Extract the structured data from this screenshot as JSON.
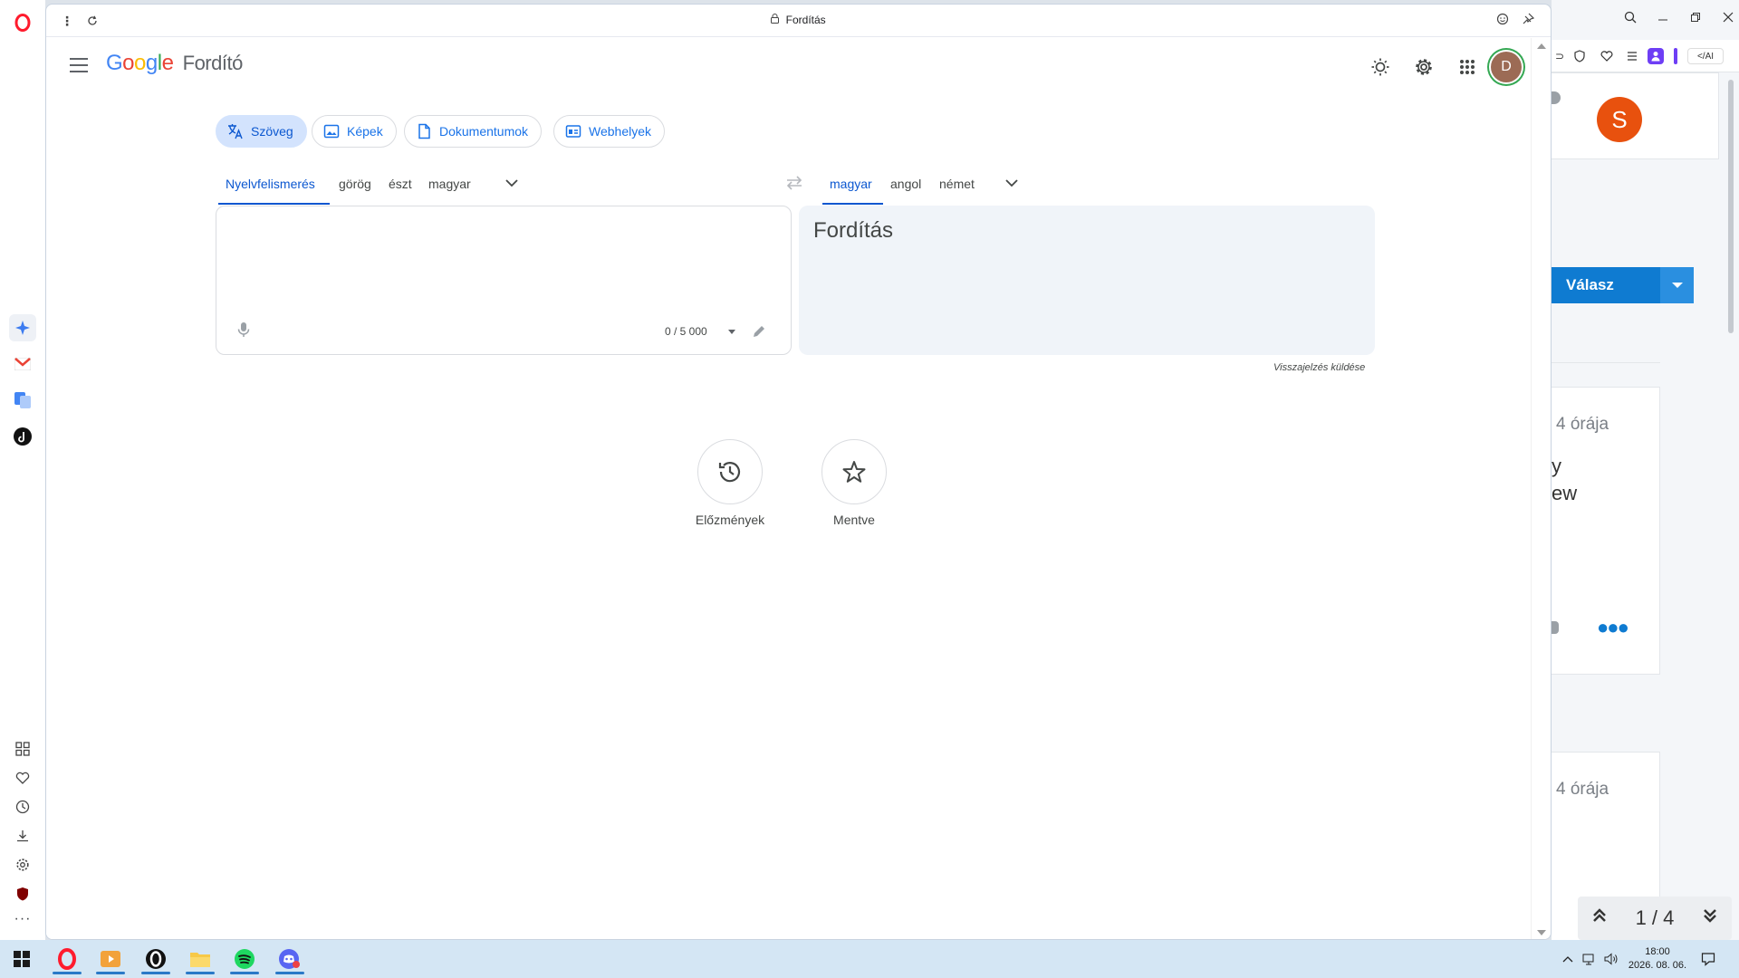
{
  "window": {
    "tab_title": "Fordítás"
  },
  "header": {
    "logo_google": [
      "G",
      "o",
      "o",
      "g",
      "l",
      "e"
    ],
    "product_name": "Fordító",
    "avatar_letter": "D"
  },
  "modes": [
    {
      "label": "Szöveg",
      "icon": "translate-icon",
      "active": true
    },
    {
      "label": "Képek",
      "icon": "image-icon",
      "active": false
    },
    {
      "label": "Dokumentumok",
      "icon": "document-icon",
      "active": false
    },
    {
      "label": "Webhelyek",
      "icon": "website-icon",
      "active": false
    }
  ],
  "source_languages": [
    "Nyelvfelismerés",
    "görög",
    "észt",
    "magyar"
  ],
  "target_languages": [
    "magyar",
    "angol",
    "német"
  ],
  "source": {
    "char_count": "0 / 5 000"
  },
  "target": {
    "placeholder": "Fordítás"
  },
  "feedback_link": "Visszajelzés küldése",
  "shortcuts": {
    "history": "Előzmények",
    "saved": "Mentve"
  },
  "right_panel": {
    "avatar_letter": "S",
    "reply_label": "Válasz",
    "card1_time": "4 órája",
    "card1_snippet_line1": "y",
    "card1_snippet_line2": "ew",
    "card2_time": "4 órája",
    "pager": "1 / 4"
  },
  "taskbar": {
    "time": "18:00",
    "date": "2026. 08. 06."
  },
  "colors": {
    "accent": "#0b57d0",
    "active_tab_bg": "#d3e3fd",
    "target_panel_bg": "#f0f4f9",
    "reply_button": "#0f7bd1",
    "opera_red": "#ff1b2d"
  }
}
